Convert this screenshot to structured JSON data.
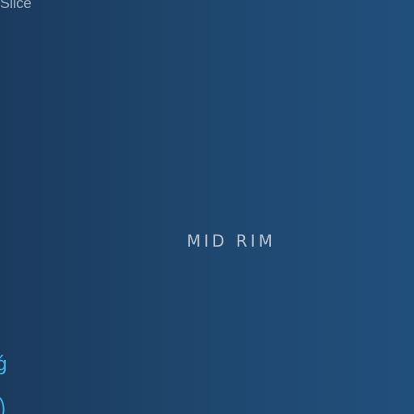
{
  "canvas": {
    "top_label": "Slice",
    "center_label": "MID RIM",
    "edge_glyph": "ǵ"
  },
  "colors": {
    "background_left": "#1b3b5e",
    "background_right": "#214f7c",
    "text_muted": "#9fb0c4",
    "label_text": "#b9c3cf",
    "accent_cyan": "#3fb6e6"
  }
}
